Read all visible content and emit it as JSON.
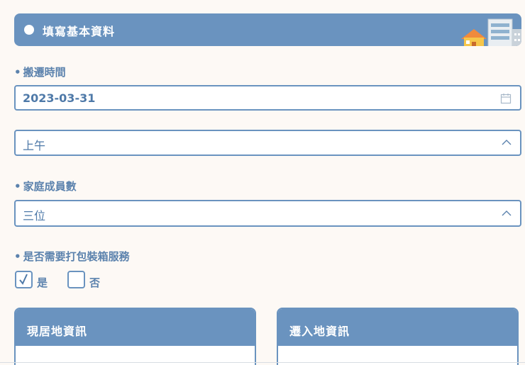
{
  "header": {
    "title": "填寫基本資料",
    "illustration": "buildings-icon"
  },
  "moving_time": {
    "label": "搬遷時間",
    "date_value": "2023-03-31",
    "period_value": "上午"
  },
  "family": {
    "label": "家庭成員數",
    "value": "三位"
  },
  "packing": {
    "label": "是否需要打包裝箱服務",
    "yes_label": "是",
    "no_label": "否",
    "yes_checked": true
  },
  "cards": {
    "current_title": "現居地資訊",
    "destination_title": "遷入地資訊"
  },
  "colors": {
    "accent": "#6a93bf",
    "text": "#5b82ad",
    "background": "#fdf9f5"
  }
}
